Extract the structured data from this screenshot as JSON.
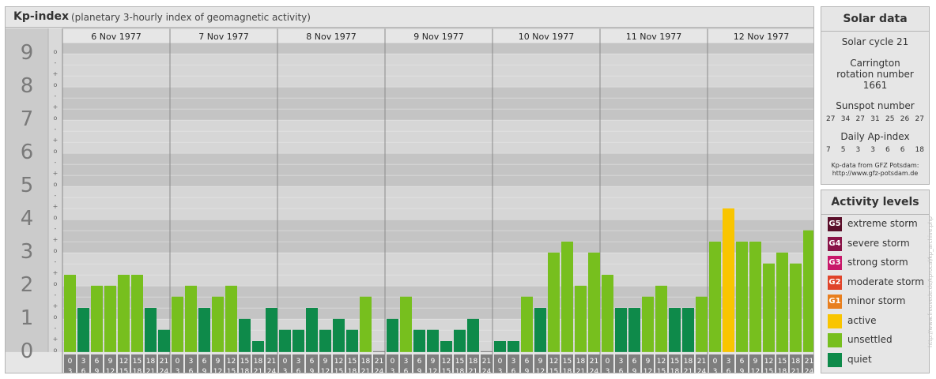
{
  "header": {
    "title": "Kp-index",
    "subtitle": "(planetary 3-hourly index of geomagnetic activity)"
  },
  "chart_data": {
    "type": "bar",
    "title": "Kp-index",
    "subtitle": "(planetary 3-hourly index of geomagnetic activity)",
    "days": [
      "6 Nov 1977",
      "7 Nov 1977",
      "8 Nov 1977",
      "9 Nov 1977",
      "10 Nov 1977",
      "11 Nov 1977",
      "12 Nov 1977"
    ],
    "hour_bins": [
      [
        "0",
        "3"
      ],
      [
        "3",
        "6"
      ],
      [
        "6",
        "9"
      ],
      [
        "9",
        "12"
      ],
      [
        "12",
        "15"
      ],
      [
        "15",
        "18"
      ],
      [
        "18",
        "21"
      ],
      [
        "21",
        "24"
      ]
    ],
    "y_ticks": [
      "0",
      "1",
      "2",
      "3",
      "4",
      "5",
      "6",
      "7",
      "8",
      "9"
    ],
    "sub_ticks": [
      "o",
      "+",
      "-",
      "o",
      "+",
      "-",
      "o",
      "+",
      "-",
      "o",
      "+",
      "-",
      "o",
      "+",
      "-",
      "o",
      "+",
      "-",
      "o",
      "+",
      "-",
      "o",
      "+",
      "-",
      "o",
      "+",
      "-",
      "o"
    ],
    "ylim": [
      0,
      9.33
    ],
    "series": [
      {
        "values": [
          2.33,
          1.33,
          2.0,
          2.0,
          2.33,
          2.33,
          1.33,
          0.67,
          1.67,
          2.0,
          1.33,
          1.67,
          2.0,
          1.0,
          0.33,
          1.33,
          0.67,
          0.67,
          1.33,
          0.67,
          1.0,
          0.67,
          1.67,
          0.0,
          1.0,
          1.67,
          0.67,
          0.67,
          0.33,
          0.67,
          1.0,
          0.0,
          0.33,
          0.33,
          1.67,
          1.33,
          3.0,
          3.33,
          2.0,
          3.0,
          2.33,
          1.33,
          1.33,
          1.67,
          2.0,
          1.33,
          1.33,
          1.67,
          3.33,
          4.33,
          3.33,
          3.33,
          2.67,
          3.0,
          2.67,
          3.67
        ]
      }
    ],
    "activity_colors": {
      "quiet": "#0e8a4a",
      "unsettled": "#77bf1e",
      "active": "#f9c500"
    }
  },
  "solar": {
    "title": "Solar data",
    "cycle": "Solar cycle 21",
    "carrington": "Carrington rotation number 1661",
    "sunspot_label": "Sunspot number",
    "sunspot": [
      "27",
      "34",
      "27",
      "31",
      "25",
      "26",
      "27"
    ],
    "ap_label": "Daily Ap-index",
    "ap": [
      "7",
      "5",
      "3",
      "3",
      "6",
      "6",
      "18"
    ],
    "source_line1": "Kp-data from GFZ Potsdam:",
    "source_line2": "http://www.gfz-potsdam.de"
  },
  "levels": {
    "title": "Activity levels",
    "items": [
      {
        "code": "G5",
        "label": "extreme storm",
        "color": "#5a0f2a"
      },
      {
        "code": "G4",
        "label": "severe storm",
        "color": "#8a1448"
      },
      {
        "code": "G3",
        "label": "strong storm",
        "color": "#c8186a"
      },
      {
        "code": "G2",
        "label": "moderate storm",
        "color": "#e0442a"
      },
      {
        "code": "G1",
        "label": "minor storm",
        "color": "#e87f1e"
      },
      {
        "code": "",
        "label": "active",
        "color": "#f9c500"
      },
      {
        "code": "",
        "label": "unsettled",
        "color": "#77bf1e"
      },
      {
        "code": "",
        "label": "quiet",
        "color": "#0e8a4a"
      }
    ]
  },
  "watermark": "http://www.freuvede.de/kprocal/kp_archive.php"
}
